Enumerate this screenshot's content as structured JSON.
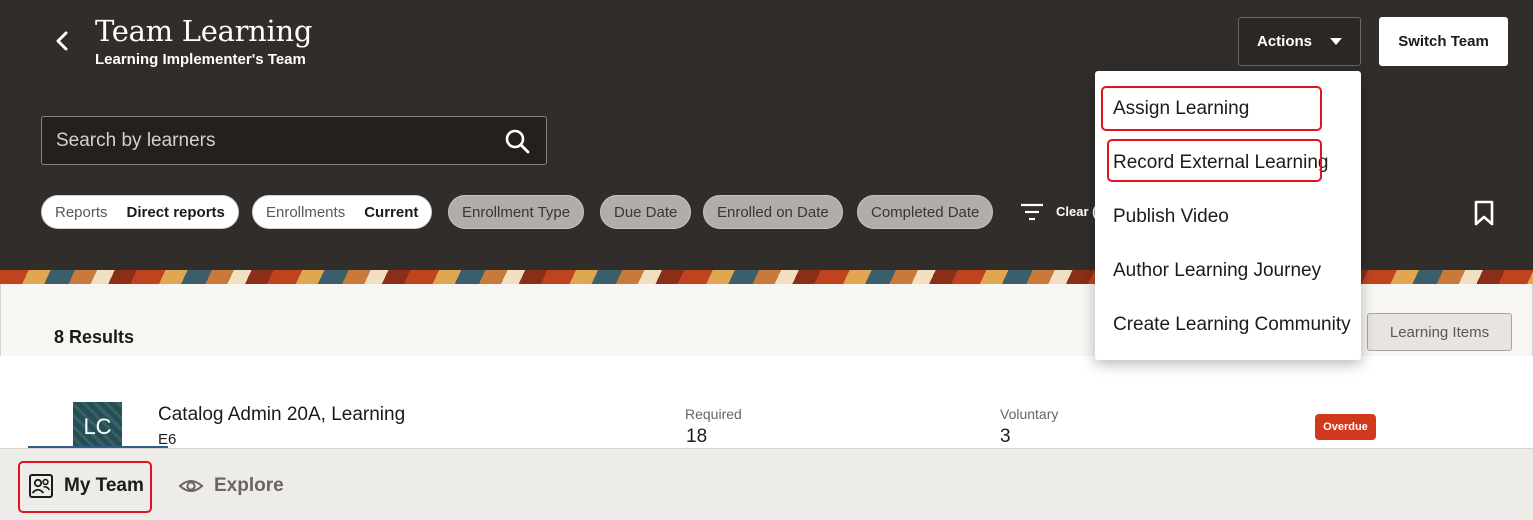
{
  "header": {
    "title": "Team Learning",
    "subtitle": "Learning Implementer's Team",
    "actions_label": "Actions",
    "switch_team_label": "Switch Team"
  },
  "search": {
    "placeholder": "Search by learners",
    "value": ""
  },
  "filters": {
    "chips": [
      {
        "key": "Reports",
        "value": "Direct reports"
      },
      {
        "key": "Enrollments",
        "value": "Current"
      }
    ],
    "optional": [
      "Enrollment Type",
      "Due Date",
      "Enrolled on Date",
      "Completed Date"
    ],
    "clear_label": "Clear ("
  },
  "actions_menu": {
    "items": [
      "Assign Learning",
      "Record External Learning",
      "Publish Video",
      "Author Learning Journey",
      "Create Learning Community"
    ]
  },
  "results": {
    "count_text": "8 Results",
    "view_toggle_label": "Learning Items"
  },
  "learners": [
    {
      "initials": "LC",
      "name": "Catalog Admin 20A, Learning",
      "level": "E6",
      "required_label": "Required",
      "required_value": "18",
      "voluntary_label": "Voluntary",
      "voluntary_value": "3",
      "status_badge": "Overdue"
    }
  ],
  "bottom_tabs": [
    {
      "label": "My Team",
      "icon": "team-icon",
      "selected": true
    },
    {
      "label": "Explore",
      "icon": "eye-icon",
      "selected": false
    }
  ],
  "colors": {
    "header_bg": "#312d2a",
    "badge_overdue": "#d2381c",
    "highlight_annotation": "#e0141e",
    "avatar_bg": "#274d55"
  }
}
